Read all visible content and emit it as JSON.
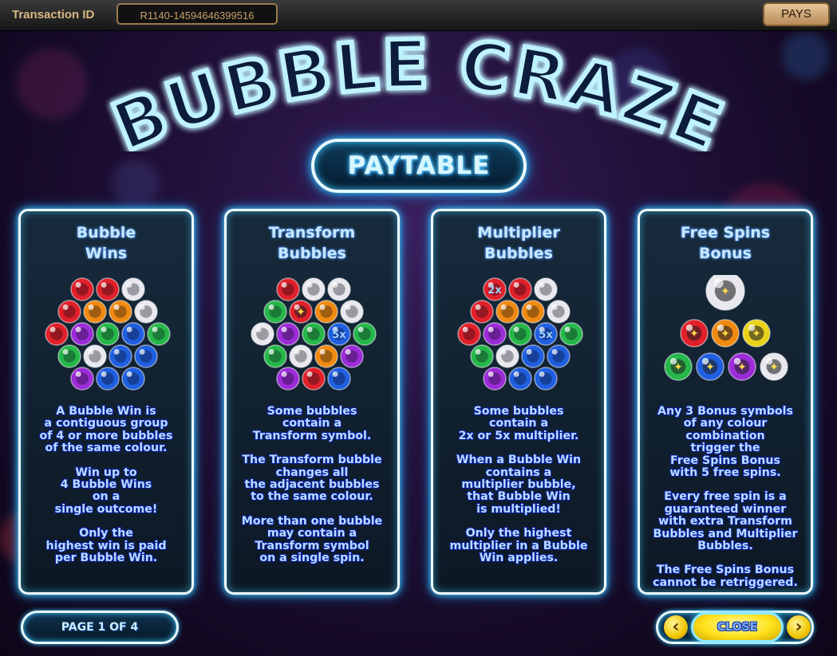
{
  "topbar": {
    "transaction_label": "Transaction ID",
    "transaction_id": "R1140-14594646399516",
    "pays_label": "PAYS"
  },
  "game": {
    "title": "BUBBLE CRAZE",
    "subtitle": "PAYTABLE"
  },
  "panels": [
    {
      "title": "Bubble\nWins",
      "icon": "bubble-cluster-icon",
      "paragraphs": [
        "A Bubble Win is\na contiguous group\nof 4 or more bubbles\nof the same colour.",
        "Win up to\n4 Bubble Wins\non a\nsingle outcome!",
        "Only the\nhighest win is paid\nper Bubble Win."
      ]
    },
    {
      "title": "Transform\nBubbles",
      "icon": "transform-bubble-cluster-icon",
      "paragraphs": [
        "Some bubbles\ncontain a\nTransform symbol.",
        "The Transform bubble\nchanges all\nthe adjacent bubbles\nto the same colour.",
        "More than one bubble\nmay contain a\nTransform symbol\non a single spin."
      ]
    },
    {
      "title": "Multiplier\nBubbles",
      "icon": "multiplier-bubble-cluster-icon",
      "paragraphs": [
        "Some bubbles\ncontain a\n2x or 5x multiplier.",
        "When a Bubble Win\ncontains a\nmultiplier bubble,\nthat Bubble Win\nis multiplied!",
        "Only the highest\nmultiplier in a Bubble\nWin applies."
      ]
    },
    {
      "title": "Free Spins\nBonus",
      "icon": "bonus-bubbles-icon",
      "paragraphs": [
        "Any 3 Bonus symbols\nof any colour\ncombination\ntrigger the\nFree Spins Bonus\nwith 5 free spins.",
        "Every free spin is a\nguaranteed winner\nwith extra Transform\nBubbles and Multiplier\nBubbles.",
        "The Free Spins Bonus\ncannot be retriggered."
      ]
    }
  ],
  "cluster_markers": {
    "multiplier_2x": "2x",
    "multiplier_5x": "5x"
  },
  "footer": {
    "page_indicator": "PAGE 1 OF 4",
    "close_label": "CLOSE",
    "prev_icon": "chevron-left-icon",
    "next_icon": "chevron-right-icon"
  },
  "colors": {
    "neon_blue": "#37c8ff",
    "panel_text": "#b9dcff",
    "gold": "#f2c400",
    "red": "#e0202a",
    "orange": "#f08a10",
    "white": "#e8e8ee",
    "green": "#26b84a",
    "purple": "#9c2bd8",
    "blue": "#1f5fe0",
    "yellow": "#e8d21a"
  }
}
